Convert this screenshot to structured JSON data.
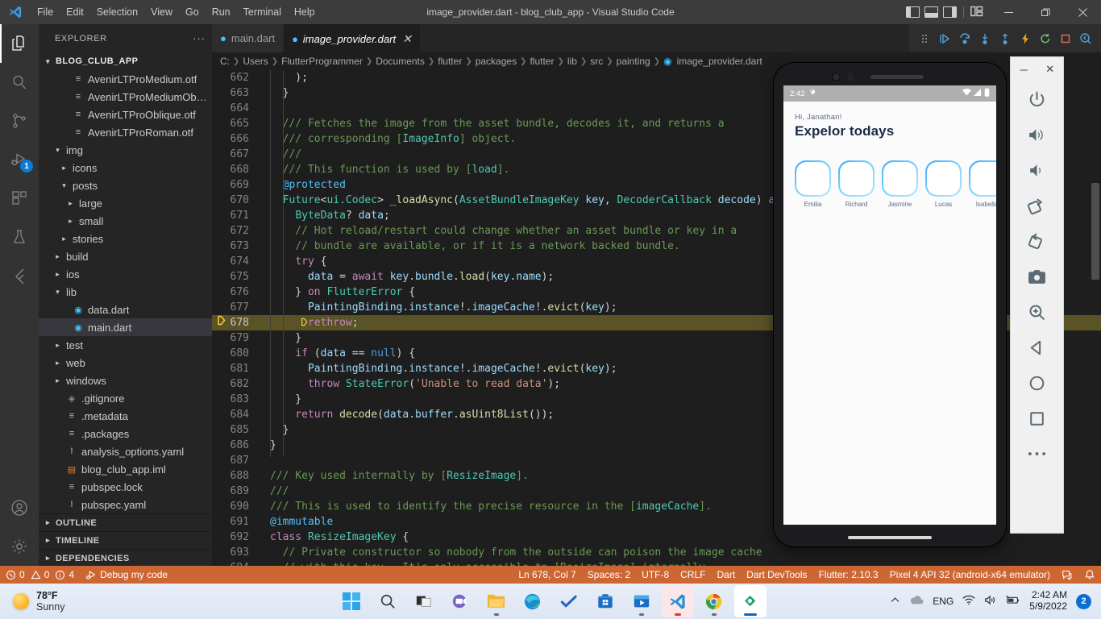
{
  "titlebar": {
    "title": "image_provider.dart - blog_club_app - Visual Studio Code",
    "menus": [
      "File",
      "Edit",
      "Selection",
      "View",
      "Go",
      "Run",
      "Terminal",
      "Help"
    ],
    "minimize": "─",
    "maximize": "❐",
    "close": "✕"
  },
  "activitybar": {
    "items": [
      {
        "name": "explorer",
        "badge": ""
      },
      {
        "name": "search",
        "badge": ""
      },
      {
        "name": "source-control",
        "badge": ""
      },
      {
        "name": "run-and-debug",
        "badge": "1"
      },
      {
        "name": "extensions",
        "badge": ""
      },
      {
        "name": "testing",
        "badge": ""
      },
      {
        "name": "flutter",
        "badge": ""
      }
    ],
    "bottom": [
      "accounts",
      "settings"
    ]
  },
  "sidebar": {
    "header": "EXPLORER",
    "more_label": "···",
    "project": "BLOG_CLUB_APP",
    "tree": [
      {
        "label": "AvenirLTProMedium.otf",
        "indent": 3,
        "type": "file",
        "icon": "text",
        "chev": ""
      },
      {
        "label": "AvenirLTProMediumObliqu...",
        "indent": 3,
        "type": "file",
        "icon": "text",
        "chev": ""
      },
      {
        "label": "AvenirLTProOblique.otf",
        "indent": 3,
        "type": "file",
        "icon": "text",
        "chev": ""
      },
      {
        "label": "AvenirLTProRoman.otf",
        "indent": 3,
        "type": "file",
        "icon": "text",
        "chev": ""
      },
      {
        "label": "img",
        "indent": 2,
        "type": "folder",
        "icon": "",
        "chev": "⌄"
      },
      {
        "label": "icons",
        "indent": 3,
        "type": "folder",
        "icon": "",
        "chev": "›"
      },
      {
        "label": "posts",
        "indent": 3,
        "type": "folder",
        "icon": "",
        "chev": "⌄"
      },
      {
        "label": "large",
        "indent": 4,
        "type": "folder",
        "icon": "",
        "chev": "›"
      },
      {
        "label": "small",
        "indent": 4,
        "type": "folder",
        "icon": "",
        "chev": "›"
      },
      {
        "label": "stories",
        "indent": 3,
        "type": "folder",
        "icon": "",
        "chev": "›"
      },
      {
        "label": "build",
        "indent": 2,
        "type": "folder",
        "icon": "",
        "chev": "›"
      },
      {
        "label": "ios",
        "indent": 2,
        "type": "folder",
        "icon": "",
        "chev": "›"
      },
      {
        "label": "lib",
        "indent": 2,
        "type": "folder",
        "icon": "",
        "chev": "⌄"
      },
      {
        "label": "data.dart",
        "indent": 3,
        "type": "file",
        "icon": "dart",
        "chev": ""
      },
      {
        "label": "main.dart",
        "indent": 3,
        "type": "file",
        "icon": "dart",
        "chev": "",
        "selected": true
      },
      {
        "label": "test",
        "indent": 2,
        "type": "folder",
        "icon": "",
        "chev": "›"
      },
      {
        "label": "web",
        "indent": 2,
        "type": "folder",
        "icon": "",
        "chev": "›"
      },
      {
        "label": "windows",
        "indent": 2,
        "type": "folder",
        "icon": "",
        "chev": "›"
      },
      {
        "label": ".gitignore",
        "indent": 2,
        "type": "file",
        "icon": "git",
        "chev": ""
      },
      {
        "label": ".metadata",
        "indent": 2,
        "type": "file",
        "icon": "text",
        "chev": ""
      },
      {
        "label": ".packages",
        "indent": 2,
        "type": "file",
        "icon": "text",
        "chev": ""
      },
      {
        "label": "analysis_options.yaml",
        "indent": 2,
        "type": "file",
        "icon": "yaml",
        "chev": ""
      },
      {
        "label": "blog_club_app.iml",
        "indent": 2,
        "type": "file",
        "icon": "iml",
        "chev": ""
      },
      {
        "label": "pubspec.lock",
        "indent": 2,
        "type": "file",
        "icon": "text",
        "chev": ""
      },
      {
        "label": "pubspec.yaml",
        "indent": 2,
        "type": "file",
        "icon": "yaml",
        "chev": ""
      }
    ],
    "sections": [
      "OUTLINE",
      "TIMELINE",
      "DEPENDENCIES"
    ]
  },
  "editor": {
    "tabs": [
      {
        "label": "main.dart",
        "active": false,
        "closable": false
      },
      {
        "label": "image_provider.dart",
        "active": true,
        "closable": true,
        "close": "✕"
      }
    ],
    "breadcrumb": [
      "C:",
      "Users",
      "FlutterProgrammer",
      "Documents",
      "flutter",
      "packages",
      "flutter",
      "lib",
      "src",
      "painting",
      "image_provider.dart"
    ],
    "breadcrumb_sep": "›",
    "debug_toolbar": [
      "drag-handle",
      "continue",
      "step-over",
      "step-into",
      "step-out",
      "hot-reload",
      "restart",
      "stop",
      "hot-restart"
    ],
    "current_line": 678,
    "first_line": 662,
    "lines": [
      {
        "n": 662,
        "tokens": [
          {
            "t": "    );",
            "c": "c-pln"
          }
        ]
      },
      {
        "n": 663,
        "tokens": [
          {
            "t": "  }",
            "c": "c-pln"
          }
        ]
      },
      {
        "n": 664,
        "tokens": [
          {
            "t": "",
            "c": "c-pln"
          }
        ]
      },
      {
        "n": 665,
        "tokens": [
          {
            "t": "  /// Fetches the image from the asset bundle, decodes it, and returns a",
            "c": "c-doc"
          }
        ]
      },
      {
        "n": 666,
        "tokens": [
          {
            "t": "  /// corresponding [",
            "c": "c-doc"
          },
          {
            "t": "ImageInfo",
            "c": "c-ref"
          },
          {
            "t": "] object.",
            "c": "c-doc"
          }
        ]
      },
      {
        "n": 667,
        "tokens": [
          {
            "t": "  ///",
            "c": "c-doc"
          }
        ]
      },
      {
        "n": 668,
        "tokens": [
          {
            "t": "  /// This function is used by [",
            "c": "c-doc"
          },
          {
            "t": "load",
            "c": "c-ref"
          },
          {
            "t": "].",
            "c": "c-doc"
          }
        ]
      },
      {
        "n": 669,
        "tokens": [
          {
            "t": "  ",
            "c": "c-pln"
          },
          {
            "t": "@protected",
            "c": "c-ann"
          }
        ]
      },
      {
        "n": 670,
        "tokens": [
          {
            "t": "  ",
            "c": "c-pln"
          },
          {
            "t": "Future",
            "c": "c-type"
          },
          {
            "t": "<",
            "c": "c-pln"
          },
          {
            "t": "ui.Codec",
            "c": "c-type"
          },
          {
            "t": "> ",
            "c": "c-pln"
          },
          {
            "t": "_loadAsync",
            "c": "c-fn"
          },
          {
            "t": "(",
            "c": "c-pln"
          },
          {
            "t": "AssetBundleImageKey",
            "c": "c-type"
          },
          {
            "t": " key",
            "c": "c-var"
          },
          {
            "t": ", ",
            "c": "c-pln"
          },
          {
            "t": "DecoderCallback",
            "c": "c-type"
          },
          {
            "t": " decode",
            "c": "c-var"
          },
          {
            "t": ") ",
            "c": "c-pln"
          },
          {
            "t": "as",
            "c": "c-kw"
          }
        ]
      },
      {
        "n": 671,
        "tokens": [
          {
            "t": "    ",
            "c": "c-pln"
          },
          {
            "t": "ByteData",
            "c": "c-type"
          },
          {
            "t": "? ",
            "c": "c-pln"
          },
          {
            "t": "data",
            "c": "c-var"
          },
          {
            "t": ";",
            "c": "c-pln"
          }
        ]
      },
      {
        "n": 672,
        "tokens": [
          {
            "t": "    // Hot reload/restart could change whether an asset bundle or key in a",
            "c": "c-com"
          }
        ]
      },
      {
        "n": 673,
        "tokens": [
          {
            "t": "    // bundle are available, or if it is a network backed bundle.",
            "c": "c-com"
          }
        ]
      },
      {
        "n": 674,
        "tokens": [
          {
            "t": "    ",
            "c": "c-pln"
          },
          {
            "t": "try",
            "c": "c-kw"
          },
          {
            "t": " {",
            "c": "c-pln"
          }
        ]
      },
      {
        "n": 675,
        "tokens": [
          {
            "t": "      ",
            "c": "c-pln"
          },
          {
            "t": "data",
            "c": "c-var"
          },
          {
            "t": " = ",
            "c": "c-pln"
          },
          {
            "t": "await",
            "c": "c-kw"
          },
          {
            "t": " ",
            "c": "c-pln"
          },
          {
            "t": "key",
            "c": "c-var"
          },
          {
            "t": ".",
            "c": "c-pln"
          },
          {
            "t": "bundle",
            "c": "c-var"
          },
          {
            "t": ".",
            "c": "c-pln"
          },
          {
            "t": "load",
            "c": "c-fn"
          },
          {
            "t": "(",
            "c": "c-pln"
          },
          {
            "t": "key",
            "c": "c-var"
          },
          {
            "t": ".",
            "c": "c-pln"
          },
          {
            "t": "name",
            "c": "c-var"
          },
          {
            "t": ");",
            "c": "c-pln"
          }
        ]
      },
      {
        "n": 676,
        "tokens": [
          {
            "t": "    } ",
            "c": "c-pln"
          },
          {
            "t": "on",
            "c": "c-kw"
          },
          {
            "t": " ",
            "c": "c-pln"
          },
          {
            "t": "FlutterError",
            "c": "c-type"
          },
          {
            "t": " {",
            "c": "c-pln"
          }
        ]
      },
      {
        "n": 677,
        "tokens": [
          {
            "t": "      ",
            "c": "c-pln"
          },
          {
            "t": "PaintingBinding",
            "c": "c-var"
          },
          {
            "t": ".",
            "c": "c-pln"
          },
          {
            "t": "instance",
            "c": "c-var"
          },
          {
            "t": "!.",
            "c": "c-pln"
          },
          {
            "t": "imageCache",
            "c": "c-var"
          },
          {
            "t": "!.",
            "c": "c-pln"
          },
          {
            "t": "evict",
            "c": "c-fn"
          },
          {
            "t": "(",
            "c": "c-pln"
          },
          {
            "t": "key",
            "c": "c-var"
          },
          {
            "t": ");",
            "c": "c-pln"
          }
        ]
      },
      {
        "n": 678,
        "tokens": [
          {
            "t": "      ",
            "c": "c-pln"
          },
          {
            "t": "rethrow",
            "c": "c-kw"
          },
          {
            "t": ";",
            "c": "c-pln"
          }
        ],
        "current": true,
        "breakpoint": true
      },
      {
        "n": 679,
        "tokens": [
          {
            "t": "    }",
            "c": "c-pln"
          }
        ]
      },
      {
        "n": 680,
        "tokens": [
          {
            "t": "    ",
            "c": "c-pln"
          },
          {
            "t": "if",
            "c": "c-kw"
          },
          {
            "t": " (",
            "c": "c-pln"
          },
          {
            "t": "data",
            "c": "c-var"
          },
          {
            "t": " == ",
            "c": "c-pln"
          },
          {
            "t": "null",
            "c": "c-kw2"
          },
          {
            "t": ") {",
            "c": "c-pln"
          }
        ]
      },
      {
        "n": 681,
        "tokens": [
          {
            "t": "      ",
            "c": "c-pln"
          },
          {
            "t": "PaintingBinding",
            "c": "c-var"
          },
          {
            "t": ".",
            "c": "c-pln"
          },
          {
            "t": "instance",
            "c": "c-var"
          },
          {
            "t": "!.",
            "c": "c-pln"
          },
          {
            "t": "imageCache",
            "c": "c-var"
          },
          {
            "t": "!.",
            "c": "c-pln"
          },
          {
            "t": "evict",
            "c": "c-fn"
          },
          {
            "t": "(",
            "c": "c-pln"
          },
          {
            "t": "key",
            "c": "c-var"
          },
          {
            "t": ");",
            "c": "c-pln"
          }
        ]
      },
      {
        "n": 682,
        "tokens": [
          {
            "t": "      ",
            "c": "c-pln"
          },
          {
            "t": "throw",
            "c": "c-kw"
          },
          {
            "t": " ",
            "c": "c-pln"
          },
          {
            "t": "StateError",
            "c": "c-type"
          },
          {
            "t": "(",
            "c": "c-pln"
          },
          {
            "t": "'Unable to read data'",
            "c": "c-str"
          },
          {
            "t": ");",
            "c": "c-pln"
          }
        ]
      },
      {
        "n": 683,
        "tokens": [
          {
            "t": "    }",
            "c": "c-pln"
          }
        ]
      },
      {
        "n": 684,
        "tokens": [
          {
            "t": "    ",
            "c": "c-pln"
          },
          {
            "t": "return",
            "c": "c-kw"
          },
          {
            "t": " ",
            "c": "c-pln"
          },
          {
            "t": "decode",
            "c": "c-fn"
          },
          {
            "t": "(",
            "c": "c-pln"
          },
          {
            "t": "data",
            "c": "c-var"
          },
          {
            "t": ".",
            "c": "c-pln"
          },
          {
            "t": "buffer",
            "c": "c-var"
          },
          {
            "t": ".",
            "c": "c-pln"
          },
          {
            "t": "asUint8List",
            "c": "c-fn"
          },
          {
            "t": "());",
            "c": "c-pln"
          }
        ]
      },
      {
        "n": 685,
        "tokens": [
          {
            "t": "  }",
            "c": "c-pln"
          }
        ]
      },
      {
        "n": 686,
        "tokens": [
          {
            "t": "}",
            "c": "c-pln"
          }
        ]
      },
      {
        "n": 687,
        "tokens": [
          {
            "t": "",
            "c": "c-pln"
          }
        ]
      },
      {
        "n": 688,
        "tokens": [
          {
            "t": "/// Key used internally by [",
            "c": "c-doc"
          },
          {
            "t": "ResizeImage",
            "c": "c-ref"
          },
          {
            "t": "].",
            "c": "c-doc"
          }
        ]
      },
      {
        "n": 689,
        "tokens": [
          {
            "t": "///",
            "c": "c-doc"
          }
        ]
      },
      {
        "n": 690,
        "tokens": [
          {
            "t": "/// This is used to identify the precise resource in the [",
            "c": "c-doc"
          },
          {
            "t": "imageCache",
            "c": "c-ref"
          },
          {
            "t": "].",
            "c": "c-doc"
          }
        ]
      },
      {
        "n": 691,
        "tokens": [
          {
            "t": "@immutable",
            "c": "c-ann"
          }
        ]
      },
      {
        "n": 692,
        "tokens": [
          {
            "t": "class",
            "c": "c-kw"
          },
          {
            "t": " ",
            "c": "c-pln"
          },
          {
            "t": "ResizeImageKey",
            "c": "c-type"
          },
          {
            "t": " {",
            "c": "c-pln"
          }
        ]
      },
      {
        "n": 693,
        "tokens": [
          {
            "t": "  // Private constructor so nobody from the outside can poison the image cache",
            "c": "c-com"
          }
        ]
      },
      {
        "n": 694,
        "tokens": [
          {
            "t": "  // with this key.  It's only accessible to [ResizeImage] internally.",
            "c": "c-com"
          }
        ]
      }
    ]
  },
  "statusbar": {
    "errors": "0",
    "warnings": "0",
    "infos": "4",
    "debug_label": "Debug my code",
    "position": "Ln 678, Col 7",
    "spaces": "Spaces: 2",
    "encoding": "UTF-8",
    "eol": "CRLF",
    "language": "Dart",
    "devtools": "Dart DevTools",
    "flutter_version": "Flutter: 2.10.3",
    "device": "Pixel 4 API 32 (android-x64 emulator)"
  },
  "emulator": {
    "window_minimize": "─",
    "window_close": "✕",
    "toolbar_buttons": [
      "power-icon",
      "volume-up-icon",
      "volume-down-icon",
      "rotate-left-icon",
      "rotate-right-icon",
      "camera-icon",
      "zoom-icon",
      "back-icon",
      "home-icon",
      "overview-icon",
      "more-icon"
    ],
    "android_statusbar": {
      "time": "2:42",
      "icons": [
        "settings-gear-icon",
        "wifi-icon",
        "signal-icon",
        "battery-icon"
      ]
    },
    "app": {
      "greeting": "Hi, Janathan!",
      "title": "Expelor todays",
      "stories": [
        "Emilia",
        "Richard",
        "Jasmine",
        "Lucas",
        "Isabella"
      ]
    }
  },
  "taskbar": {
    "weather": {
      "temp": "78°F",
      "condition": "Sunny"
    },
    "apps": [
      {
        "name": "start-button"
      },
      {
        "name": "search-button"
      },
      {
        "name": "task-view-button"
      },
      {
        "name": "teams-button"
      },
      {
        "name": "file-explorer-button"
      },
      {
        "name": "edge-button"
      },
      {
        "name": "todo-button"
      },
      {
        "name": "microsoft-store-button"
      },
      {
        "name": "media-player-button"
      },
      {
        "name": "vscode-button"
      },
      {
        "name": "chrome-button"
      },
      {
        "name": "android-emulator-button"
      }
    ],
    "tray": {
      "language": "ENG",
      "time": "2:42 AM",
      "date": "5/9/2022",
      "badge": "2"
    }
  },
  "colors": {
    "status_accent": "#cc6633",
    "current_line": "#5a5326",
    "badge_blue": "#0e7ad4"
  }
}
